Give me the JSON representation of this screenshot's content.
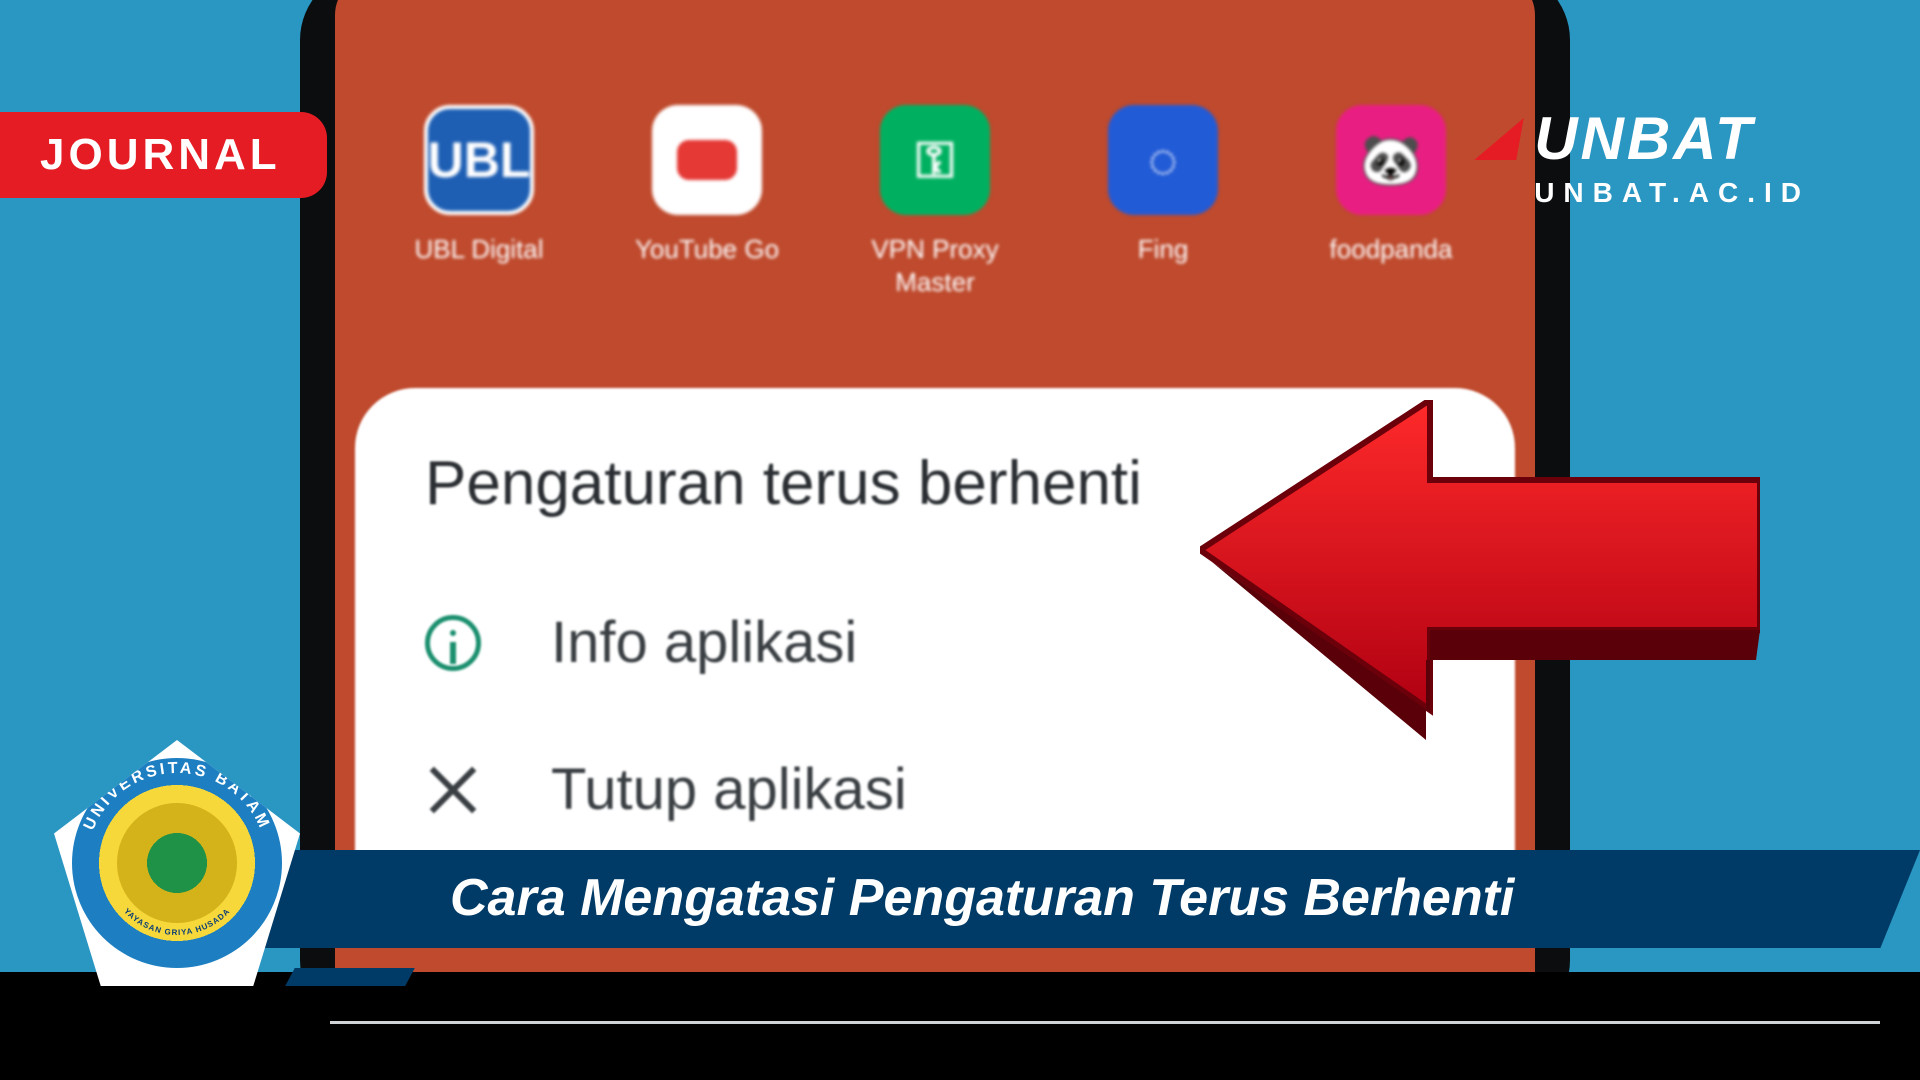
{
  "badge": {
    "label": "JOURNAL"
  },
  "brand": {
    "name": "UNBAT",
    "url": "UNBAT.AC.ID"
  },
  "phone": {
    "apps": [
      {
        "name": "UBL Digital",
        "icon": "ubl"
      },
      {
        "name": "YouTube Go",
        "icon": "yt"
      },
      {
        "name": "VPN Proxy Master",
        "icon": "vpn"
      },
      {
        "name": "Fing",
        "icon": "fing"
      },
      {
        "name": "foodpanda",
        "icon": "fp"
      }
    ],
    "dialog": {
      "title": "Pengaturan terus berhenti",
      "option_info": "Info aplikasi",
      "option_close": "Tutup aplikasi"
    }
  },
  "lower_third": {
    "caption": "Cara Mengatasi Pengaturan Terus Berhenti"
  },
  "seal": {
    "top_text": "UNIVERSITAS BATAM",
    "bottom_text": "YAYASAN GRIYA HUSADA"
  },
  "icons": {
    "info": "info-icon",
    "close": "close-icon",
    "arrow": "red-arrow-left-icon",
    "brand_tri": "triangle-icon"
  }
}
